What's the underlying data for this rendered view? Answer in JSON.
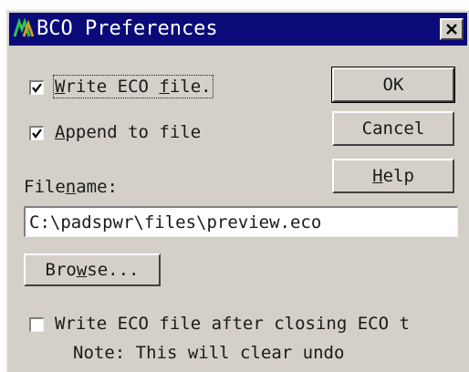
{
  "window": {
    "title": "BCO Preferences",
    "icon": "app-icon",
    "close_icon": "close-icon",
    "title_bg": "#0a0a78",
    "dialog_bg": "#d4d0c8"
  },
  "options": {
    "write_eco": {
      "prefix": "",
      "mnemonic": "W",
      "rest": "rite ECO ",
      "mnemonic2": "f",
      "rest2": "ile.",
      "checked": true
    },
    "append": {
      "prefix": "",
      "mnemonic": "A",
      "rest": "ppend to file",
      "checked": true
    },
    "write_after_closing": {
      "label": "Write ECO file after closing ECO t",
      "checked": false
    }
  },
  "filename": {
    "label_pre": "File",
    "label_mnemonic": "n",
    "label_post": "ame:",
    "value": "C:\\padspwr\\files\\preview.eco"
  },
  "buttons": {
    "ok": "OK",
    "cancel": "Cancel",
    "help_mnemonic": "H",
    "help_rest": "elp",
    "browse_pre": "Bro",
    "browse_mnemonic": "w",
    "browse_post": "se..."
  },
  "note": "Note: This will clear undo"
}
